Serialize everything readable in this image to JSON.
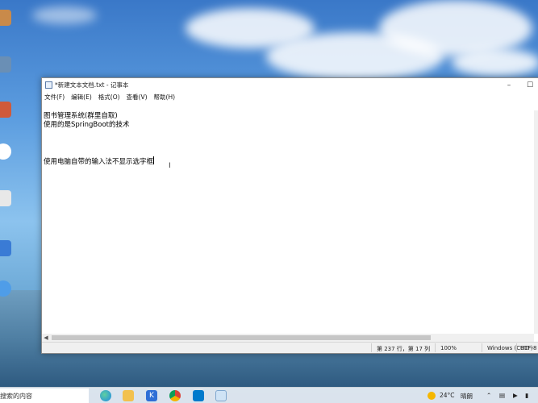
{
  "window": {
    "title": "*新建文本文档.txt - 记事本",
    "minimize_glyph": "–",
    "maximize_glyph": "☐"
  },
  "menu": {
    "items": [
      "文件(F)",
      "编辑(E)",
      "格式(O)",
      "查看(V)",
      "帮助(H)"
    ]
  },
  "editor": {
    "lines": [
      "图书管理系统(群里自取)",
      "使用的是SpringBoot的技术",
      "",
      "",
      "",
      "使用电脑自带的输入法不显示选字框"
    ]
  },
  "statusbar": {
    "position": "第 237 行，第 17 列",
    "zoom": "100%",
    "line_ending": "Windows (CRLF)",
    "encoding": "UTF-8"
  },
  "taskbar": {
    "search_placeholder": "搜索的内容",
    "temperature": "24°C",
    "weather": "晴朗"
  },
  "colors": {
    "accent": "#0078d4",
    "edge": "#1e88e5",
    "vscode": "#007acc"
  }
}
